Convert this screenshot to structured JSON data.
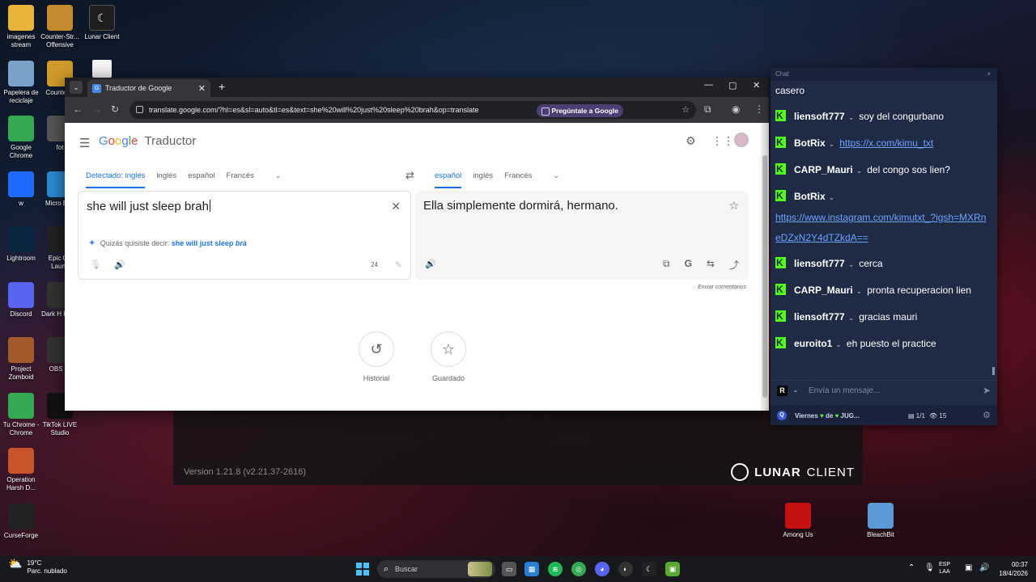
{
  "desktop": {
    "icons_left": [
      {
        "label": "imagenes stream",
        "icon": "folder-icon",
        "color": "#e8b53a"
      },
      {
        "label": "Papelera de reciclaje",
        "icon": "recycle-bin-icon",
        "color": "#7aa2c8"
      },
      {
        "label": "Google Chrome",
        "icon": "chrome-icon",
        "color": "#34a853"
      },
      {
        "label": "w",
        "icon": "roblox-icon",
        "color": "#1f6bff"
      },
      {
        "label": "Lightroom",
        "icon": "lightroom-icon",
        "color": "#0a2540"
      },
      {
        "label": "Discord",
        "icon": "discord-icon",
        "color": "#5865f2"
      },
      {
        "label": "Project Zomboid",
        "icon": "zomboid-icon",
        "color": "#a35a2b"
      },
      {
        "label": "Tu Chrome - Chrome",
        "icon": "chrome-profile-icon",
        "color": "#34a853"
      },
      {
        "label": "Operation Harsh D...",
        "icon": "game-icon",
        "color": "#c8542a"
      },
      {
        "label": "CurseForge",
        "icon": "curseforge-icon",
        "color": "#222222"
      }
    ],
    "icons_col2": [
      {
        "label": "Counter-Str... Offensive",
        "icon": "csgo-icon",
        "color": "#c68a2e"
      },
      {
        "label": "Counter 2",
        "icon": "cs2-icon",
        "color": "#d29a2a"
      },
      {
        "label": "fot",
        "icon": "photo-icon",
        "color": "#555555"
      },
      {
        "label": "Micro Edg",
        "icon": "edge-icon",
        "color": "#2a8ad4"
      },
      {
        "label": "Epic Ga Launc",
        "icon": "epic-icon",
        "color": "#222222"
      },
      {
        "label": "Dark H Prolo",
        "icon": "game-icon",
        "color": "#333333"
      },
      {
        "label": "OBS St",
        "icon": "obs-icon",
        "color": "#333333"
      },
      {
        "label": "TikTok LIVE Studio",
        "icon": "tiktok-icon",
        "color": "#111111"
      }
    ],
    "lunar_icon": {
      "label": "Lunar Client",
      "icon": "lunar-icon"
    },
    "file_icon": {
      "label": "",
      "icon": "file-icon"
    },
    "right_icons": [
      {
        "label": "Among Us",
        "icon": "among-us-icon",
        "color": "#c51111"
      },
      {
        "label": "BleachBit",
        "icon": "bleachbit-icon",
        "color": "#5a9bd5"
      }
    ]
  },
  "lunar": {
    "version": "Version 1.21.8 (v2.21.37-2616)",
    "brand_bold": "LUNAR",
    "brand_rest": "CLIENT"
  },
  "browser": {
    "tab_title": "Traductor de Google",
    "url": "translate.google.com/?hl=es&sl=auto&tl=es&text=she%20will%20just%20sleep%20brah&op=translate",
    "ask_google": "Pregúntale a Google"
  },
  "translate": {
    "logo": {
      "g1": "G",
      "g2": "o",
      "g3": "o",
      "g4": "g",
      "g5": "l",
      "g6": "e",
      "product": "Traductor"
    },
    "source_langs": [
      "Detectado: inglés",
      "inglés",
      "español",
      "Francés"
    ],
    "target_langs": [
      "español",
      "inglés",
      "Francés"
    ],
    "source_text": "she will just sleep brah",
    "suggestion_prefix": "Quizás quisiste decir:",
    "suggestion_plain": "she will just sleep",
    "suggestion_em": "bra",
    "char_count": "24",
    "translation": "Ella simplemente dormirá, hermano.",
    "feedback": "Enviar comentarios",
    "history_label": "Historial",
    "saved_label": "Guardado"
  },
  "chat": {
    "header": "Chat",
    "top_line": "casero",
    "messages": [
      {
        "user": "liensoft777",
        "text": "soy del congurbano",
        "link": ""
      },
      {
        "user": "BotRix",
        "text": "",
        "link": "https://x.com/kimu_txt"
      },
      {
        "user": "CARP_Mauri",
        "text": "del congo sos lien?",
        "link": ""
      },
      {
        "user": "BotRix",
        "text": "",
        "link": "https://www.instagram.com/kimutxt_?igsh=MXRneDZxN2Y4dTZkdA=="
      },
      {
        "user": "liensoft777",
        "text": "cerca",
        "link": ""
      },
      {
        "user": "CARP_Mauri",
        "text": "pronta recuperacion lien",
        "link": ""
      },
      {
        "user": "liensoft777",
        "text": "gracias mauri",
        "link": ""
      },
      {
        "user": "euroito1",
        "text": "eh puesto el practice",
        "link": ""
      }
    ],
    "input_placeholder": "Envía un mensaje...",
    "badge_letter": "R",
    "footer_text_1": "Viernes",
    "footer_text_2": "de",
    "footer_text_3": "JUG...",
    "footer_count": "1/1",
    "footer_viewers": "15",
    "accent": "#53fc18"
  },
  "taskbar": {
    "temp": "19°C",
    "weather": "Parc. nublado",
    "search": "Buscar",
    "lang_1": "ESP",
    "lang_2": "LAA",
    "time": "00:37",
    "date": "18/4/2026"
  }
}
